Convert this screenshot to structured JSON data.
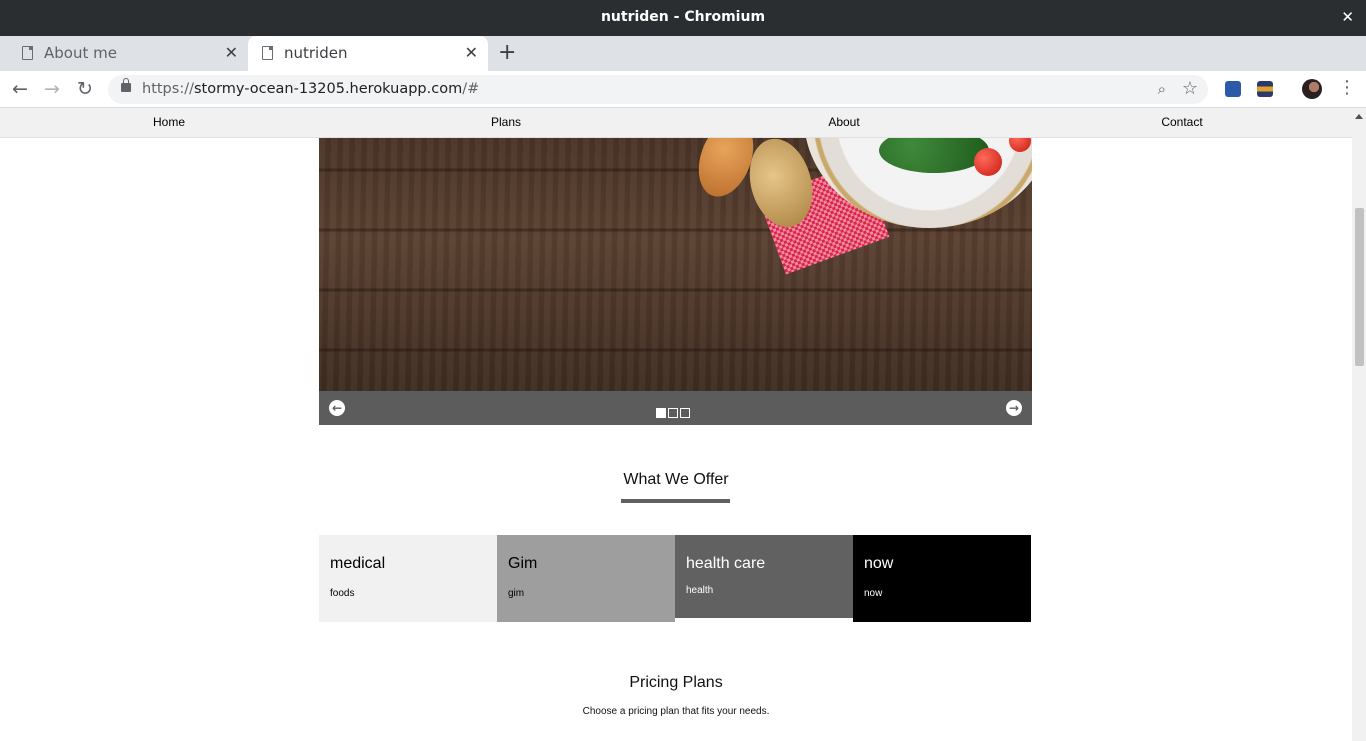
{
  "window": {
    "title": "nutriden - Chromium",
    "close_glyph": "✕"
  },
  "tabs": [
    {
      "label": "About me",
      "close": "✕"
    },
    {
      "label": "nutriden",
      "close": "✕"
    }
  ],
  "new_tab": "+",
  "address": {
    "scheme": "https://",
    "host": "stormy-ocean-13205.herokuapp.com",
    "path": "/#"
  },
  "site_nav": [
    "Home",
    "Plans",
    "About",
    "Contact"
  ],
  "slideshow": {
    "prev": "←",
    "next": "→",
    "slide_count": 3,
    "active_slide": 1
  },
  "offer": {
    "heading": "What We Offer",
    "cards": [
      {
        "title": "medical",
        "sub": "foods",
        "bg": "#f1f1f1",
        "fg": "#000000"
      },
      {
        "title": "Gim",
        "sub": "gim",
        "bg": "#9e9e9e",
        "fg": "#000000"
      },
      {
        "title": "health care",
        "sub": "health",
        "bg": "#616161",
        "fg": "#ffffff"
      },
      {
        "title": "now",
        "sub": "now",
        "bg": "#000000",
        "fg": "#ffffff"
      }
    ]
  },
  "pricing": {
    "heading": "Pricing Plans",
    "sub": "Choose a pricing plan that fits your needs."
  }
}
